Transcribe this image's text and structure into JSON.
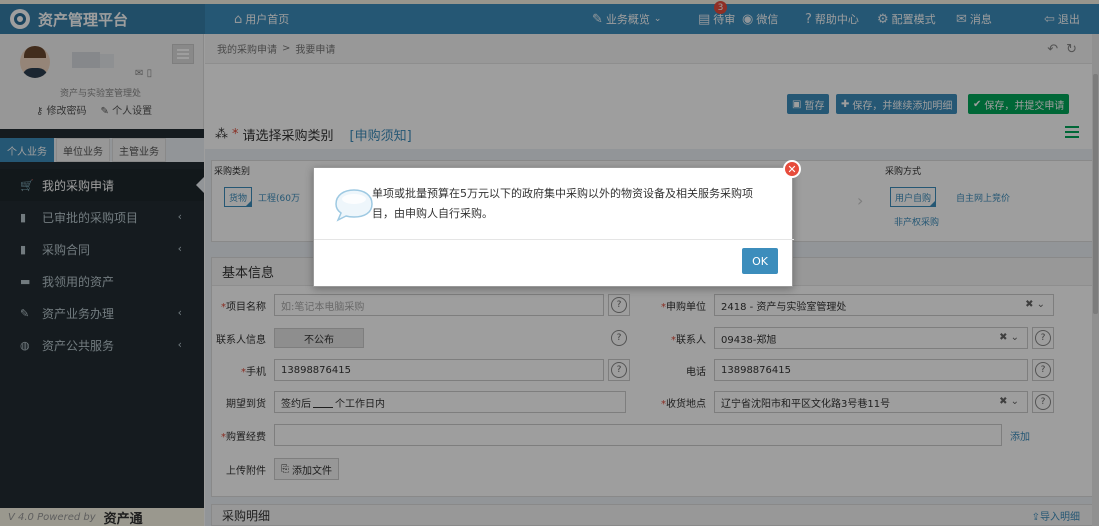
{
  "brand": {
    "title": "资产管理平台"
  },
  "topnav": {
    "home": "用户首页",
    "overview": "业务概览",
    "todo": "待审",
    "todo_badge": "3",
    "wechat": "微信",
    "help": "帮助中心",
    "config": "配置模式",
    "messages": "消息",
    "logout": "退出"
  },
  "user": {
    "dept": "资产与实验室管理处",
    "change_password": "修改密码",
    "profile": "个人设置"
  },
  "sidebar_tabs": [
    "个人业务",
    "单位业务",
    "主管业务"
  ],
  "menu": [
    {
      "label": "我的采购申请",
      "icon": "cart-icon"
    },
    {
      "label": "已审批的采购项目",
      "icon": "bookmark-icon"
    },
    {
      "label": "采购合同",
      "icon": "bookmark-icon"
    },
    {
      "label": "我领用的资产",
      "icon": "stack-icon"
    },
    {
      "label": "资产业务办理",
      "icon": "pencil-icon"
    },
    {
      "label": "资产公共服务",
      "icon": "globe-icon"
    }
  ],
  "footer": {
    "version": "V 4.0 Powered by",
    "brand": "资产通"
  },
  "breadcrumb": {
    "parent": "我的采购申请",
    "sep": ">",
    "current": "我要申请"
  },
  "toolbar": {
    "save_draft": "暂存",
    "save_continue": "保存，并继续添加明细",
    "save_submit": "保存，并提交申请"
  },
  "section": {
    "prompt": "请选择采购类别",
    "notice": "[申购须知]"
  },
  "category": {
    "label": "采购类别",
    "method_label": "采购方式",
    "types": [
      "货物",
      "工程(60万"
    ],
    "methods": [
      "用户自购",
      "自主网上竞价",
      "非产权采购"
    ]
  },
  "basic_info": {
    "title": "基本信息",
    "project_name_label": "项目名称",
    "project_name_placeholder": "如:笔记本电脑采购",
    "applicant_unit_label": "申购单位",
    "applicant_unit": "2418 - 资产与实验室管理处",
    "contact_info_label": "联系人信息",
    "contact_info_toggle": "不公布",
    "contact_label": "联系人",
    "contact": "09438-郑旭",
    "mobile_label": "手机",
    "mobile": "13898876415",
    "phone_label": "电话",
    "phone": "13898876415",
    "delivery_label": "期望到货",
    "delivery_prefix": "签约后",
    "delivery_suffix": "个工作日内",
    "address_label": "收货地点",
    "address": "辽宁省沈阳市和平区文化路3号巷11号",
    "funds_label": "购置经费",
    "funds_add": "添加",
    "attachment_label": "上传附件",
    "attachment_button": "添加文件"
  },
  "details": {
    "title": "采购明细",
    "import": "导入明细"
  },
  "modal": {
    "message": "单项或批量预算在5万元以下的政府集中采购以外的物资设备及相关服务采购项目，由申购人自行采购。",
    "ok": "OK"
  }
}
